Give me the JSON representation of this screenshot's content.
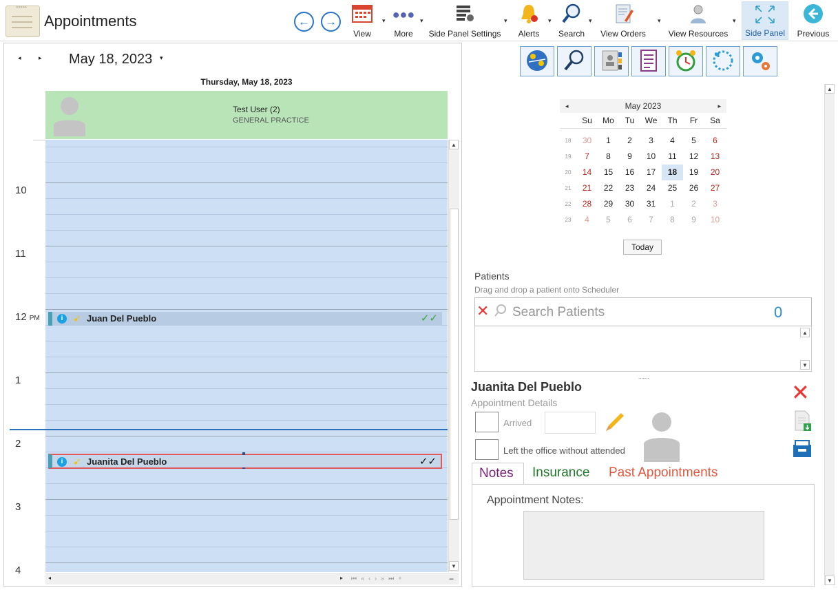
{
  "app": {
    "title": "Appointments"
  },
  "toolbar": {
    "items": [
      {
        "label": "View",
        "icon": "calendar-icon"
      },
      {
        "label": "More",
        "icon": "more-dots-icon"
      },
      {
        "label": "Side Panel Settings",
        "icon": "settings-grid-icon"
      },
      {
        "label": "Alerts",
        "icon": "bell-icon"
      },
      {
        "label": "Search",
        "icon": "search-icon"
      },
      {
        "label": "View Orders",
        "icon": "orders-icon"
      },
      {
        "label": "View Resources",
        "icon": "resources-icon"
      },
      {
        "label": "Side Panel",
        "icon": "expand-icon"
      },
      {
        "label": "Previous",
        "icon": "back-arrow-icon"
      }
    ]
  },
  "scheduler": {
    "date": "May 18, 2023",
    "day_header": "Thursday, May 18, 2023",
    "resource": {
      "name": "Test User (2)",
      "department": "GENERAL PRACTICE"
    },
    "times": [
      {
        "hour": "10",
        "ampm": ""
      },
      {
        "hour": "11",
        "ampm": ""
      },
      {
        "hour": "12",
        "ampm": "PM"
      },
      {
        "hour": "1",
        "ampm": ""
      },
      {
        "hour": "2",
        "ampm": ""
      },
      {
        "hour": "3",
        "ampm": ""
      },
      {
        "hour": "4",
        "ampm": ""
      }
    ],
    "appointments": [
      {
        "name": "Juan Del Pueblo",
        "checks": "✓✓",
        "check_color": "#3aa63a"
      },
      {
        "name": "Juanita Del Pueblo",
        "checks": "✓✓",
        "check_color": "#111111"
      }
    ]
  },
  "calendar": {
    "month": "May 2023",
    "dow": [
      "Su",
      "Mo",
      "Tu",
      "We",
      "Th",
      "Fr",
      "Sa"
    ],
    "weeks": [
      {
        "wk": "18",
        "days": [
          "30",
          "1",
          "2",
          "3",
          "4",
          "5",
          "6"
        ]
      },
      {
        "wk": "19",
        "days": [
          "7",
          "8",
          "9",
          "10",
          "11",
          "12",
          "13"
        ]
      },
      {
        "wk": "20",
        "days": [
          "14",
          "15",
          "16",
          "17",
          "18",
          "19",
          "20"
        ]
      },
      {
        "wk": "21",
        "days": [
          "21",
          "22",
          "23",
          "24",
          "25",
          "26",
          "27"
        ]
      },
      {
        "wk": "22",
        "days": [
          "28",
          "29",
          "30",
          "31",
          "1",
          "2",
          "3"
        ]
      },
      {
        "wk": "23",
        "days": [
          "4",
          "5",
          "6",
          "7",
          "8",
          "9",
          "10"
        ]
      }
    ],
    "selected": "18",
    "today_label": "Today"
  },
  "patients": {
    "title": "Patients",
    "hint": "Drag and drop a patient onto Scheduler",
    "search_placeholder": "Search Patients",
    "count": "0"
  },
  "details": {
    "patient_name": "Juanita Del Pueblo",
    "subtitle": "Appointment Details",
    "arrived_label": "Arrived",
    "left_label": "Left the office without attended"
  },
  "tabs": {
    "notes": "Notes",
    "insurance": "Insurance",
    "past": "Past Appointments"
  },
  "notes": {
    "label": "Appointment Notes:"
  }
}
